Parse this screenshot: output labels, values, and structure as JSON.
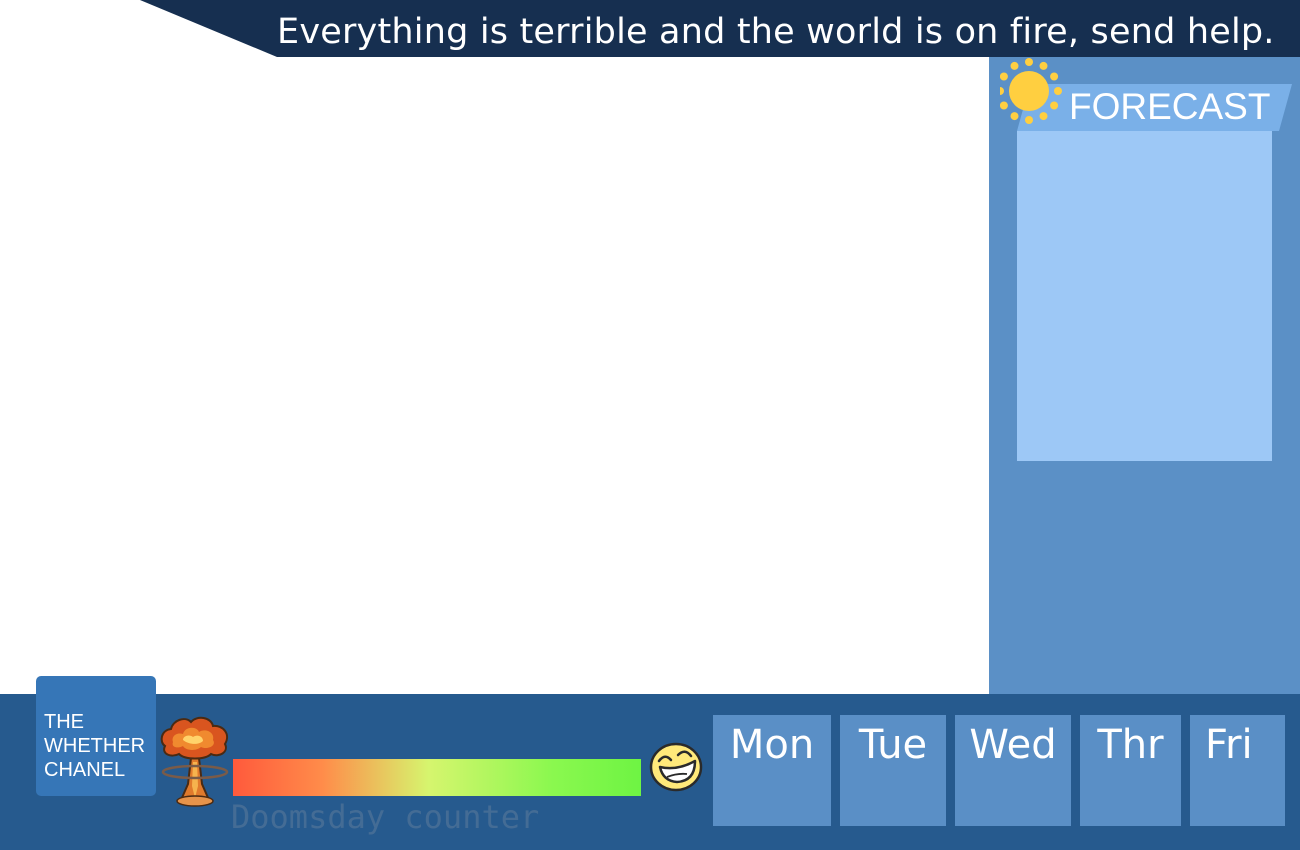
{
  "banner": {
    "text": "Everything is terrible and the world is on fire, send help."
  },
  "forecast": {
    "title": "FORECAST",
    "icon": "sun-icon"
  },
  "logo": {
    "lines": [
      "THE",
      "WHETHER",
      "CHANEL"
    ]
  },
  "doomsday": {
    "label": "Doomsday counter",
    "level": 1.0,
    "left_icon": "mushroom-cloud-icon",
    "right_icon": "laughing-face-icon"
  },
  "days": [
    "Mon",
    "Tue",
    "Wed",
    "Thr",
    "Fri"
  ],
  "colors": {
    "banner": "#162f50",
    "panel": "#5b90c6",
    "forecast_box": "#9dc8f6",
    "bottom_bar": "#265a8e",
    "logo": "#3676b7",
    "day_tile": "#5a8fc6",
    "sun": "#ffcf40",
    "meter_start": "#ff5a3c",
    "meter_end": "#6ef443"
  }
}
